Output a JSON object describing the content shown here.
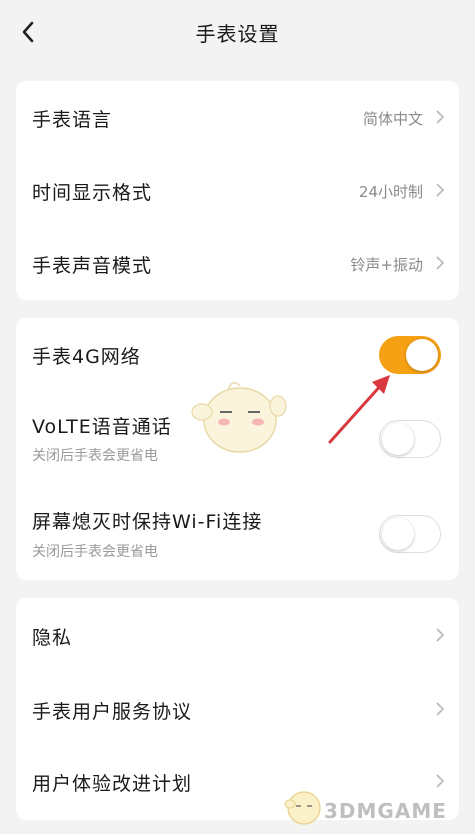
{
  "header": {
    "title": "手表设置"
  },
  "group1": {
    "items": [
      {
        "label": "手表语言",
        "value": "简体中文"
      },
      {
        "label": "时间显示格式",
        "value": "24小时制"
      },
      {
        "label": "手表声音模式",
        "value": "铃声+振动"
      }
    ]
  },
  "group2": {
    "items": [
      {
        "label": "手表4G网络",
        "toggle": "on"
      },
      {
        "label": "VoLTE语音通话",
        "sub": "关闭后手表会更省电",
        "toggle": "off"
      },
      {
        "label": "屏幕熄灭时保持Wi-Fi连接",
        "sub": "关闭后手表会更省电",
        "toggle": "off"
      }
    ]
  },
  "group3": {
    "items": [
      {
        "label": "隐私"
      },
      {
        "label": "手表用户服务协议"
      },
      {
        "label": "用户体验改进计划"
      }
    ]
  },
  "colors": {
    "accent": "#f6a114",
    "arrow": "#d9393e"
  },
  "watermark": {
    "text": "3DMGAME"
  }
}
